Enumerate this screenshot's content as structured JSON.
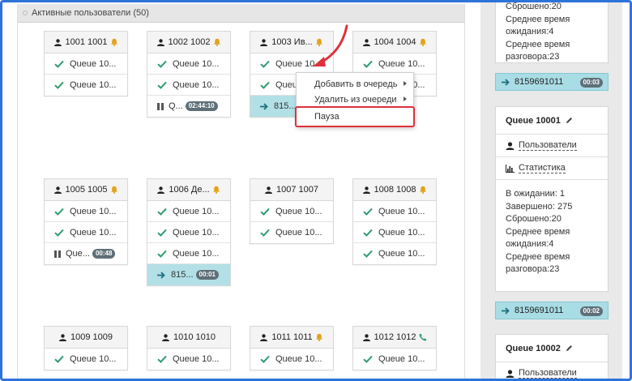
{
  "panel": {
    "title": "Активные пользователи (50)"
  },
  "users": [
    {
      "name": "1001 1001",
      "right_icon": "bell-icon",
      "rows": [
        {
          "kind": "queue",
          "label": "Queue 10..."
        },
        {
          "kind": "queue",
          "label": "Queue 10..."
        }
      ]
    },
    {
      "name": "1002 1002",
      "right_icon": "bell-icon",
      "rows": [
        {
          "kind": "queue",
          "label": "Queue 10..."
        },
        {
          "kind": "queue",
          "label": "Queue 10..."
        },
        {
          "kind": "pause",
          "label": "Q...",
          "timer": "02:44:10"
        }
      ]
    },
    {
      "name": "1003 Ив...",
      "right_icon": "bell-icon",
      "rows": [
        {
          "kind": "queue",
          "label": "Queue 10..."
        },
        {
          "kind": "queue",
          "label": "Queue 10..."
        },
        {
          "kind": "call",
          "label": "815..."
        }
      ]
    },
    {
      "name": "1004 1004",
      "right_icon": "bell-icon",
      "rows": [
        {
          "kind": "queue",
          "label": "Queue 10..."
        },
        {
          "kind": "queue",
          "label": "Queue 10..."
        }
      ]
    },
    {
      "name": "1005 1005",
      "right_icon": "bell-icon",
      "rows": [
        {
          "kind": "queue",
          "label": "Queue 10..."
        },
        {
          "kind": "queue",
          "label": "Queue 10..."
        },
        {
          "kind": "pause",
          "label": "Que...",
          "timer": "00:48"
        }
      ]
    },
    {
      "name": "1006 Де...",
      "right_icon": "bell-icon",
      "rows": [
        {
          "kind": "queue",
          "label": "Queue 10..."
        },
        {
          "kind": "queue",
          "label": "Queue 10..."
        },
        {
          "kind": "queue",
          "label": "Queue 10..."
        },
        {
          "kind": "call",
          "label": "815...",
          "timer": "00:01"
        }
      ]
    },
    {
      "name": "1007 1007",
      "right_icon": "",
      "rows": [
        {
          "kind": "queue",
          "label": "Queue 10..."
        },
        {
          "kind": "queue",
          "label": "Queue 10..."
        }
      ]
    },
    {
      "name": "1008 1008",
      "right_icon": "bell-icon",
      "rows": [
        {
          "kind": "queue",
          "label": "Queue 10..."
        },
        {
          "kind": "queue",
          "label": "Queue 10..."
        },
        {
          "kind": "queue",
          "label": "Queue 10..."
        }
      ]
    },
    {
      "name": "1009 1009",
      "right_icon": "",
      "rows": [
        {
          "kind": "queue",
          "label": "Queue 10..."
        }
      ]
    },
    {
      "name": "1010 1010",
      "right_icon": "",
      "rows": [
        {
          "kind": "queue",
          "label": "Queue 10..."
        }
      ]
    },
    {
      "name": "1011 1011",
      "right_icon": "bell-icon",
      "rows": [
        {
          "kind": "queue",
          "label": "Queue 10..."
        }
      ]
    },
    {
      "name": "1012 1012",
      "right_icon": "phone-icon",
      "rows": [
        {
          "kind": "queue",
          "label": "Queue 10..."
        }
      ]
    }
  ],
  "context_menu": {
    "add_to_queue": "Добавить в очередь",
    "remove_from_queue": "Удалить из очереди",
    "pause": "Пауза"
  },
  "queues": [
    {
      "stats_top": [
        "Сброшено:20",
        "Среднее время",
        "ожидания:4",
        "Среднее время",
        "разговора:23"
      ],
      "call_number": "8159691011",
      "call_timer": "00:03"
    },
    {
      "title": "Queue 10001",
      "users_link": "Пользователи",
      "stats_link": "Статистика",
      "stats": [
        "В ожидании: 1",
        "Завершено: 275",
        "Сброшено:20",
        "Среднее время",
        "ожидания:4",
        "Среднее время",
        "разговора:23"
      ],
      "call_number": "8159691011",
      "call_timer": "00:02"
    },
    {
      "title": "Queue 10002",
      "users_link": "Пользователи"
    }
  ],
  "colors": {
    "frame": "#2d73d9",
    "check": "#2e9c6e",
    "bell": "#e3a21a",
    "call_bg": "#b2e0e6",
    "highlight": "#e0303a"
  }
}
